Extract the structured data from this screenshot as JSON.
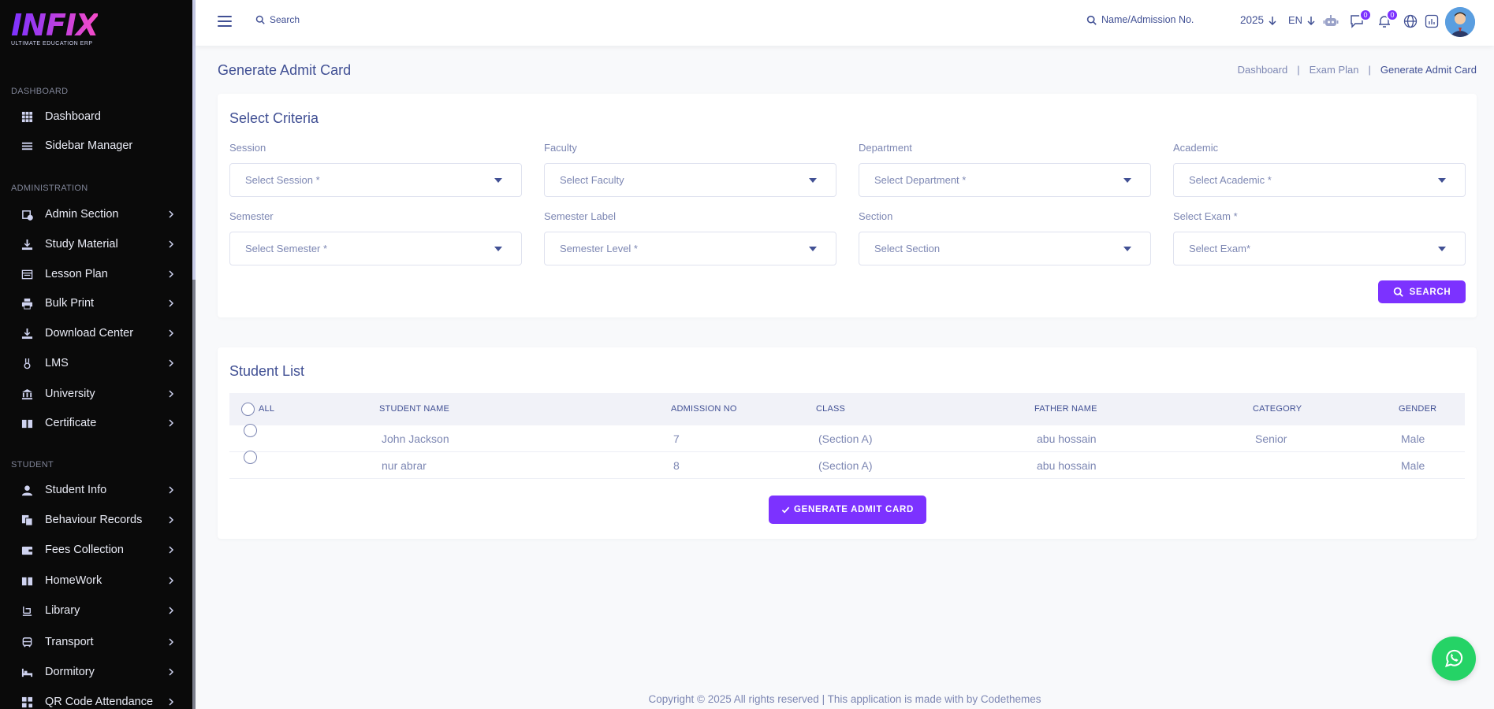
{
  "brand": {
    "logo": "INFIX",
    "tagline": "ULTIMATE EDUCATION ERP",
    "accent": "#7c32ff"
  },
  "sidebar": {
    "sections": [
      {
        "title": "DASHBOARD"
      },
      {
        "title": "ADMINISTRATION"
      },
      {
        "title": "STUDENT"
      }
    ],
    "items": [
      {
        "label": "Dashboard",
        "icon": "grid-icon"
      },
      {
        "label": "Sidebar Manager",
        "icon": "bars-icon"
      },
      {
        "label": "Admin Section",
        "icon": "admin-icon"
      },
      {
        "label": "Study Material",
        "icon": "download-icon"
      },
      {
        "label": "Lesson Plan",
        "icon": "list-icon"
      },
      {
        "label": "Bulk Print",
        "icon": "print-icon"
      },
      {
        "label": "Download Center",
        "icon": "download-icon"
      },
      {
        "label": "LMS",
        "icon": "lms-icon"
      },
      {
        "label": "University",
        "icon": "university-icon"
      },
      {
        "label": "Certificate",
        "icon": "book-icon"
      },
      {
        "label": "Student Info",
        "icon": "user-icon"
      },
      {
        "label": "Behaviour Records",
        "icon": "copy-icon"
      },
      {
        "label": "Fees Collection",
        "icon": "wallet-icon"
      },
      {
        "label": "HomeWork",
        "icon": "book-icon"
      },
      {
        "label": "Library",
        "icon": "library-icon"
      },
      {
        "label": "Transport",
        "icon": "bus-icon"
      },
      {
        "label": "Dormitory",
        "icon": "bed-icon"
      },
      {
        "label": "QR Code Attendance",
        "icon": "qr-icon"
      }
    ]
  },
  "header": {
    "search_label": "Search",
    "name_search_label": "Name/Admission No.",
    "year": "2025",
    "language": "EN",
    "messages_count": "0",
    "notifications_count": "0"
  },
  "page": {
    "title": "Generate Admit Card",
    "breadcrumb": [
      "Dashboard",
      "|",
      "Exam Plan",
      "|",
      "Generate Admit Card"
    ]
  },
  "criteria": {
    "title": "Select Criteria",
    "fields": [
      {
        "label": "Session",
        "placeholder": "Select Session *"
      },
      {
        "label": "Faculty",
        "placeholder": "Select Faculty"
      },
      {
        "label": "Department",
        "placeholder": "Select Department *"
      },
      {
        "label": "Academic",
        "placeholder": "Select Academic *"
      },
      {
        "label": "Semester",
        "placeholder": "Select Semester *"
      },
      {
        "label": "Semester Label",
        "placeholder": "Semester Level *"
      },
      {
        "label": "Section",
        "placeholder": "Select Section"
      },
      {
        "label": "Select Exam *",
        "placeholder": "Select Exam*"
      }
    ],
    "search_button": "SEARCH"
  },
  "student_list": {
    "title": "Student List",
    "columns": [
      "ALL",
      "STUDENT NAME",
      "ADMISSION NO",
      "CLASS",
      "FATHER NAME",
      "CATEGORY",
      "GENDER"
    ],
    "rows": [
      {
        "name": "John Jackson",
        "admission_no": "7",
        "class": "(Section A)",
        "father": "abu hossain",
        "category": "Senior",
        "gender": "Male"
      },
      {
        "name": "nur abrar",
        "admission_no": "8",
        "class": "(Section A)",
        "father": "abu hossain",
        "category": "",
        "gender": "Male"
      }
    ],
    "generate_button": "GENERATE ADMIT CARD"
  },
  "footer": {
    "text": "Copyright © 2025 All rights reserved | This application is made with by Codethemes"
  }
}
